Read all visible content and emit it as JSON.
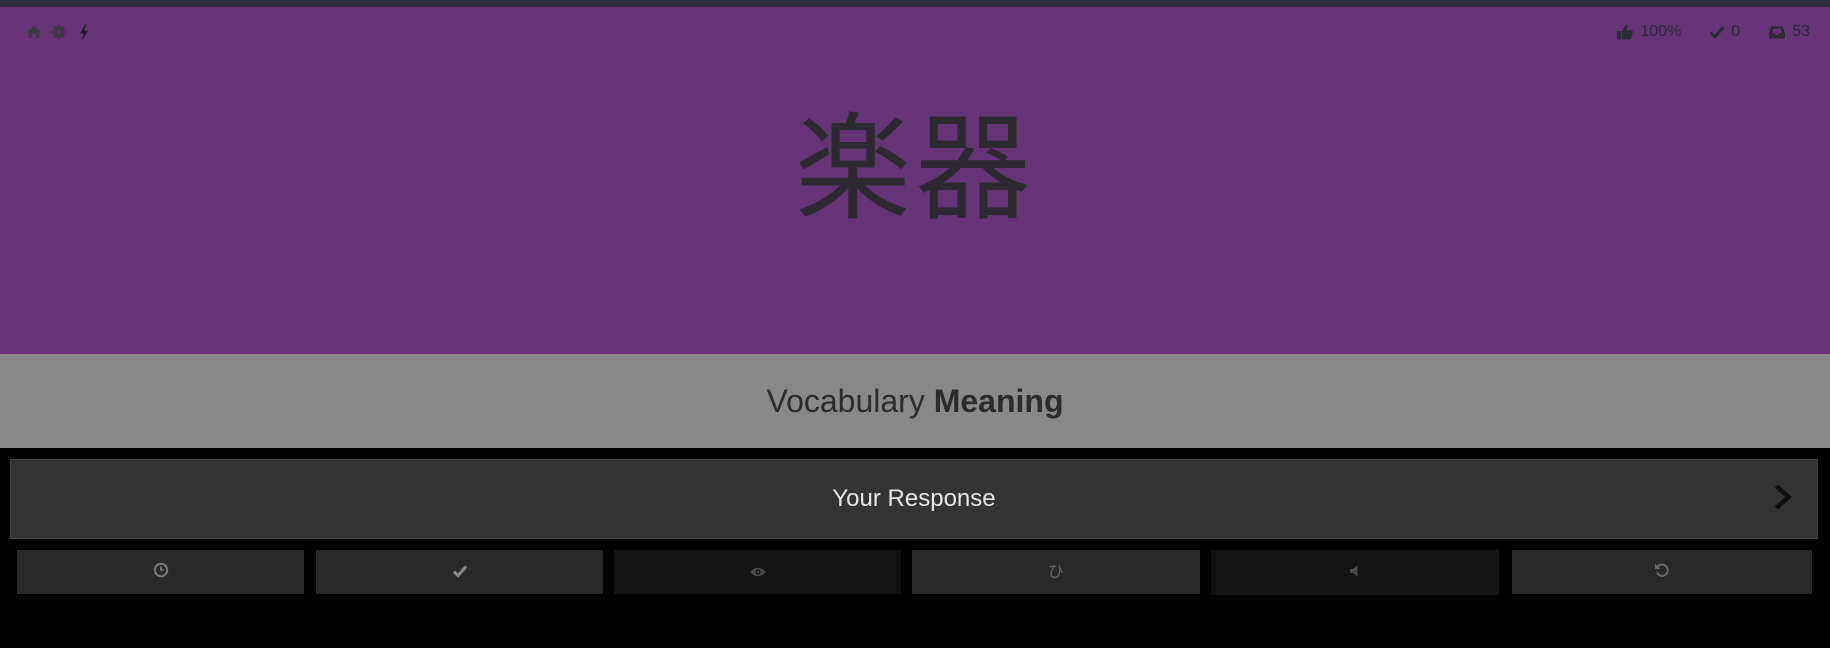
{
  "toolbar": {
    "home_icon": "home-icon",
    "settings_icon": "gear-icon",
    "lightning_icon": "lightning-icon"
  },
  "stats": {
    "accuracy": "100%",
    "completed": "0",
    "remaining": "53"
  },
  "review": {
    "character": "楽器",
    "category": "Vocabulary",
    "question_type": "Meaning",
    "answer_placeholder": "Your Response"
  },
  "actions": [
    {
      "name": "timer-button",
      "icon": "clock-icon"
    },
    {
      "name": "mark-correct-button",
      "icon": "check-icon"
    },
    {
      "name": "reveal-answer-button",
      "icon": "eye-icon"
    },
    {
      "name": "kana-input-button",
      "icon": "hiragana-hi-icon",
      "glyph": "ひ"
    },
    {
      "name": "audio-button",
      "icon": "speaker-icon"
    },
    {
      "name": "undo-button",
      "icon": "undo-icon"
    }
  ],
  "colors": {
    "character_panel": "#663377",
    "type_bar": "#888888",
    "input_bar": "#333333",
    "page_background": "#000000"
  }
}
